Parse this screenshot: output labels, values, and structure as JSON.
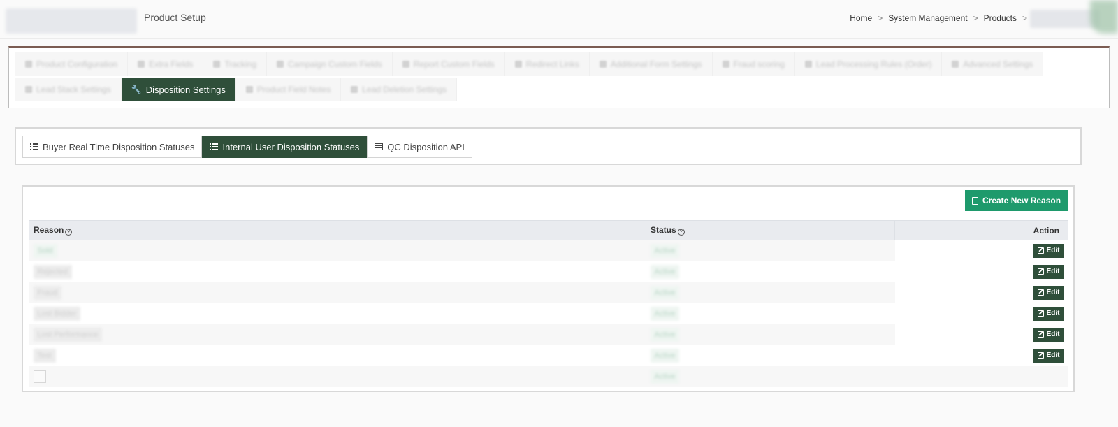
{
  "header": {
    "title": "Product Setup",
    "breadcrumb": [
      "Home",
      "System Management",
      "Products"
    ],
    "breadcrumb_separator": ">"
  },
  "settings_tabs": {
    "row1": [
      "Product Configuration",
      "Extra Fields",
      "Tracking",
      "Campaign Custom Fields",
      "Report Custom Fields",
      "Redirect Links",
      "Additional Form Settings",
      "Fraud scoring",
      "Lead Processing Rules (Order)",
      "Advanced Settings"
    ],
    "row2": [
      "Lead Stack Settings",
      "Disposition Settings",
      "Product Field Notes",
      "Lead Deletion Settings"
    ],
    "active": "Disposition Settings"
  },
  "sub_tabs": [
    {
      "label": "Buyer Real Time Disposition Statuses",
      "icon": "list-icon",
      "active": false
    },
    {
      "label": "Internal User Disposition Statuses",
      "icon": "list-icon",
      "active": true
    },
    {
      "label": "QC Disposition API",
      "icon": "table-icon",
      "active": false
    }
  ],
  "reasons": {
    "create_label": "Create New Reason",
    "columns": {
      "reason": "Reason",
      "status": "Status",
      "action": "Action"
    },
    "edit_label": "Edit",
    "rows": [
      {
        "reason": "Sold",
        "status": "Active",
        "editable": true
      },
      {
        "reason": "Rejected",
        "status": "Active",
        "editable": true
      },
      {
        "reason": "Fraud",
        "status": "Active",
        "editable": true
      },
      {
        "reason": "Lost Bidder",
        "status": "Active",
        "editable": true
      },
      {
        "reason": "Lost Performance",
        "status": "Active",
        "editable": true
      },
      {
        "reason": "Test",
        "status": "Active",
        "editable": true
      },
      {
        "reason": "",
        "status": "Active",
        "editable": false
      }
    ]
  },
  "colors": {
    "primary_dark_green": "#2f4f3a",
    "create_button_green": "#1e9a6c",
    "panel_top_border": "#7b5c52"
  }
}
